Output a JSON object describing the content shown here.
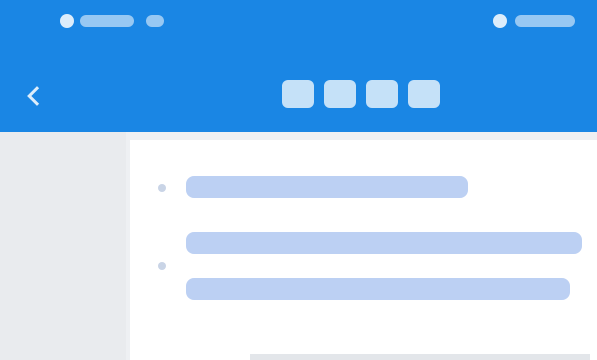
{
  "status_bar": {
    "left_text": "",
    "right_text": ""
  },
  "header": {
    "title": ""
  },
  "questions": [
    {
      "text": ""
    },
    {
      "text": ""
    }
  ],
  "colors": {
    "header_bg": "#1a86e4",
    "link_text": "#3e78d8",
    "page_bg": "#eef0f3",
    "card_bg": "#ffffff"
  },
  "icons": {
    "back": "back-arrow-icon",
    "bullet": "bullet-icon"
  }
}
